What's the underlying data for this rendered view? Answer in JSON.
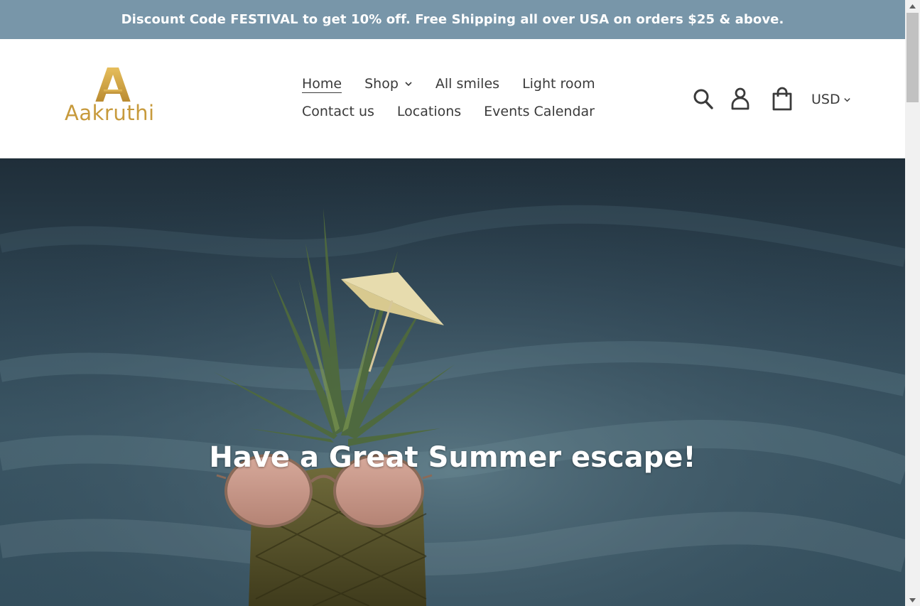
{
  "announcement": {
    "text": "Discount Code FESTIVAL to get 10% off. Free Shipping all over USA on orders $25 & above."
  },
  "brand": {
    "logo_text": "Aakruthi",
    "logo_icon": "letter-a-logo-icon",
    "color": "#c79a3c"
  },
  "nav": {
    "row1": [
      {
        "label": "Home",
        "active": true
      },
      {
        "label": "Shop",
        "has_dropdown": true
      },
      {
        "label": "All smiles"
      },
      {
        "label": "Light room"
      }
    ],
    "row2": [
      {
        "label": "Contact us"
      },
      {
        "label": "Locations"
      },
      {
        "label": "Events Calendar"
      }
    ]
  },
  "header_icons": {
    "search": "search-icon",
    "account": "user-icon",
    "cart": "shopping-bag-icon",
    "currency": "USD"
  },
  "hero": {
    "title": "Have a Great Summer escape!"
  },
  "colors": {
    "announcement_bg": "#7896a9",
    "text": "#3a3a3a",
    "hero_text": "#ffffff"
  }
}
